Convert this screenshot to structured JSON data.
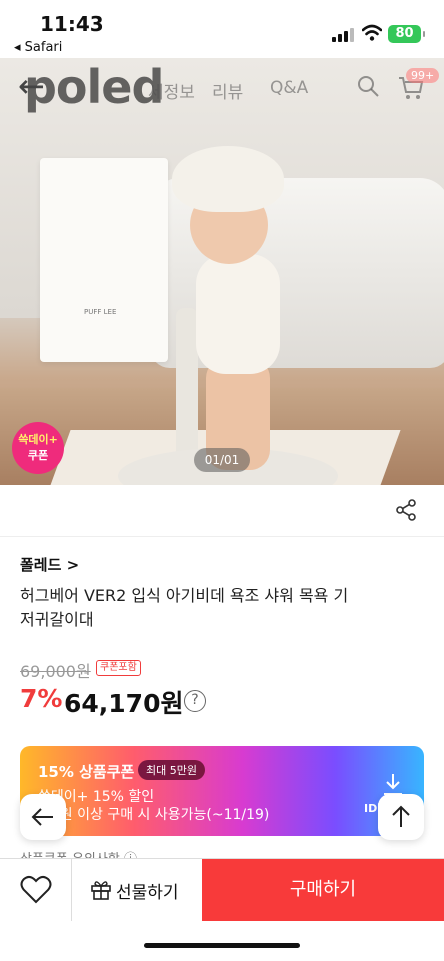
{
  "status_bar": {
    "time": "11:43",
    "back_app": "Safari",
    "battery": "80"
  },
  "header": {
    "logo": "poled",
    "nav": [
      "세정보",
      "리뷰",
      "Q&A"
    ],
    "cart_badge": "99+"
  },
  "hero": {
    "coupon_sticker_line1": "쓱데이+",
    "coupon_sticker_line2": "쿠폰",
    "image_counter": "01/01",
    "towel_text": "PUFF LEE"
  },
  "product": {
    "brand": "폴레드 >",
    "title": "허그베어 VER2 입식 아기비데 욕조 샤워 목욕 기저귀갈이대",
    "original_price": "69,000원",
    "coupon_included": "쿠폰포함",
    "discount_rate": "7%",
    "sale_price": "64,170원",
    "info_icon": "?"
  },
  "coupon_banner": {
    "title": "15% 상품쿠폰",
    "max_badge": "최대 5만원",
    "line1": "쓱데이+ 15% 할인",
    "line2": "3만원 이상 구매 시 사용가능(~11/19)",
    "download_label": "ID받",
    "accent": "#7a4dff"
  },
  "coupon_note": "상품쿠폰 유의사항",
  "bottom_bar": {
    "gift_label": "선물하기",
    "buy_label": "구매하기",
    "buy_color": "#f83a3a"
  }
}
